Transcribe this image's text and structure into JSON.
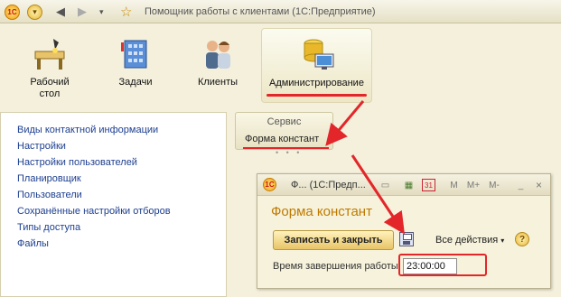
{
  "titlebar": {
    "title": "Помощник работы с клиентами (1С:Предприятие)",
    "logo": "1С"
  },
  "sections": [
    {
      "label": "Рабочий стол",
      "icon": "desk-icon"
    },
    {
      "label": "Задачи",
      "icon": "tasks-icon"
    },
    {
      "label": "Клиенты",
      "icon": "clients-icon"
    },
    {
      "label": "Администрирование",
      "icon": "admin-icon"
    }
  ],
  "nav": {
    "items": [
      "Виды контактной информации",
      "Настройки",
      "Настройки пользователей",
      "Планировщик",
      "Пользователи",
      "Сохранённые настройки отборов",
      "Типы доступа",
      "Файлы"
    ]
  },
  "service": {
    "title": "Сервис",
    "item": "Форма констант"
  },
  "form": {
    "window_title": "Ф... (1С:Предп...",
    "header": "Форма констант",
    "save_close_label": "Записать и закрыть",
    "all_actions_label": "Все действия",
    "end_time_label": "Время завершения работы:",
    "end_time_value": "23:00:00",
    "toolbar_letters": [
      "M",
      "M+",
      "M-"
    ]
  },
  "colors": {
    "accent": "#e3262a",
    "header": "#bf7a00",
    "link": "#1d3f8f"
  }
}
